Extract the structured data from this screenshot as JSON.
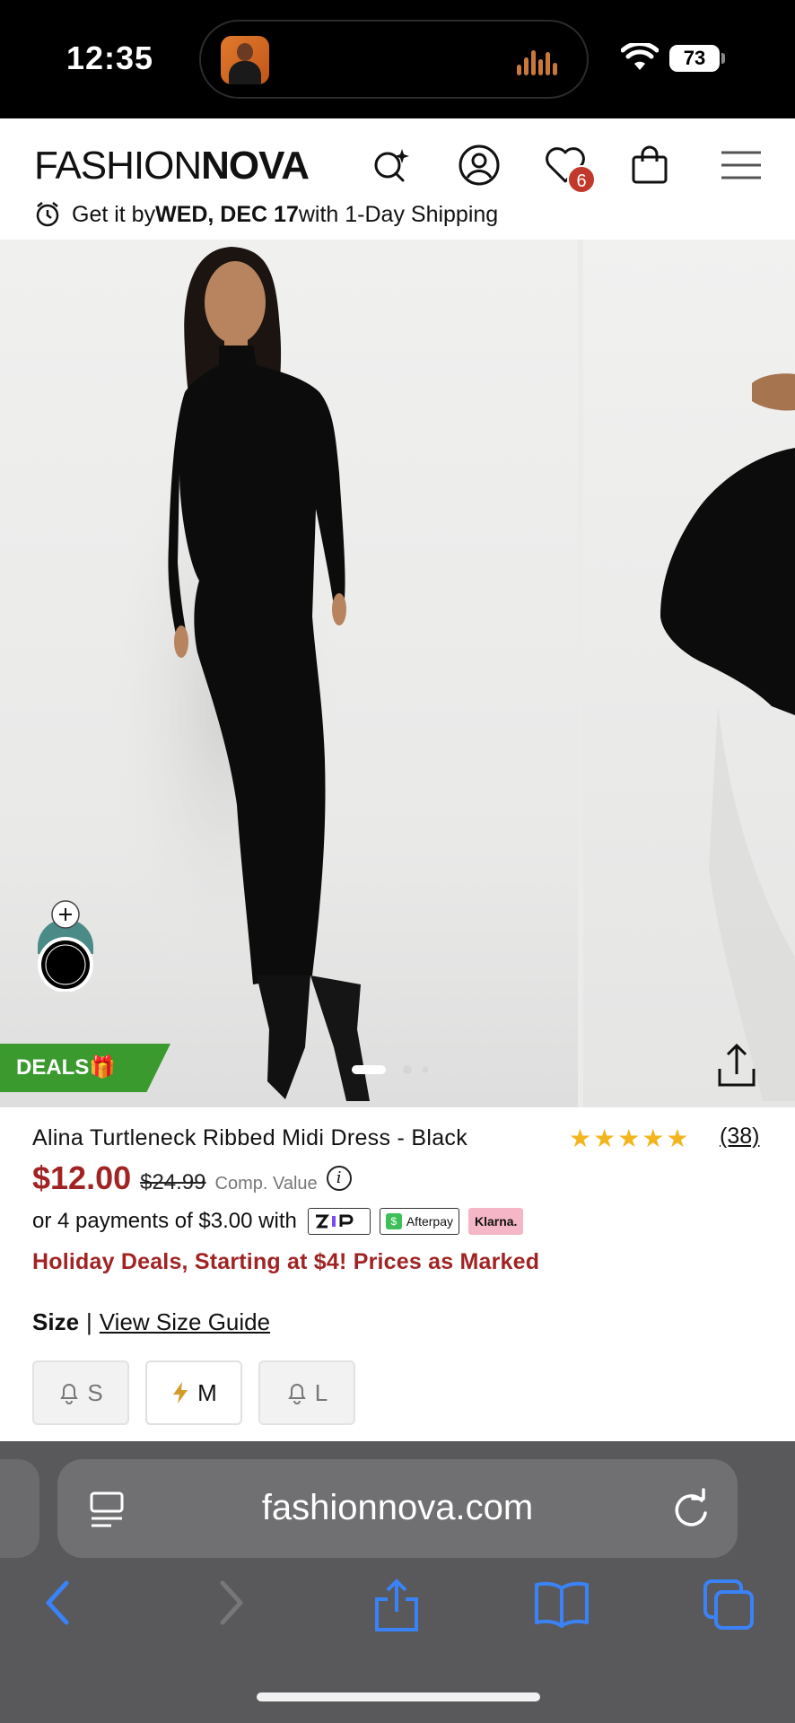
{
  "status_bar": {
    "time": "12:35",
    "battery": "73"
  },
  "header": {
    "logo_part1": "FASHION",
    "logo_part2": "NOVA",
    "wishlist_count": "6",
    "shipping": {
      "prefix": "Get it by ",
      "date": "WED, DEC 17",
      "suffix": " with 1-Day Shipping"
    }
  },
  "gallery": {
    "deals_label": "DEALS🎁",
    "slide_count": 3,
    "active_slide": 1
  },
  "product": {
    "title": "Alina Turtleneck Ribbed Midi Dress - Black",
    "rating": 5,
    "reviews": "(38)",
    "price": "$12.00",
    "compare_price": "$24.99",
    "comp_value_label": "Comp. Value",
    "installments_text": "or 4 payments of $3.00 with",
    "payment_providers": {
      "zip": "ZIP",
      "afterpay": "Afterpay",
      "klarna": "Klarna."
    },
    "promo": "Holiday Deals, Starting at $4! Prices as Marked",
    "size_label": "Size",
    "size_separator": "|",
    "size_guide": "View Size Guide",
    "sizes": [
      {
        "label": "S",
        "state": "notify"
      },
      {
        "label": "M",
        "state": "low-stock"
      },
      {
        "label": "L",
        "state": "notify"
      }
    ]
  },
  "browser": {
    "url": "fashionnova.com"
  },
  "colors": {
    "price_red": "#a12424",
    "deals_green": "#3a9a2e",
    "star_gold": "#f2b51e",
    "ios_blue": "#3a82f7"
  }
}
